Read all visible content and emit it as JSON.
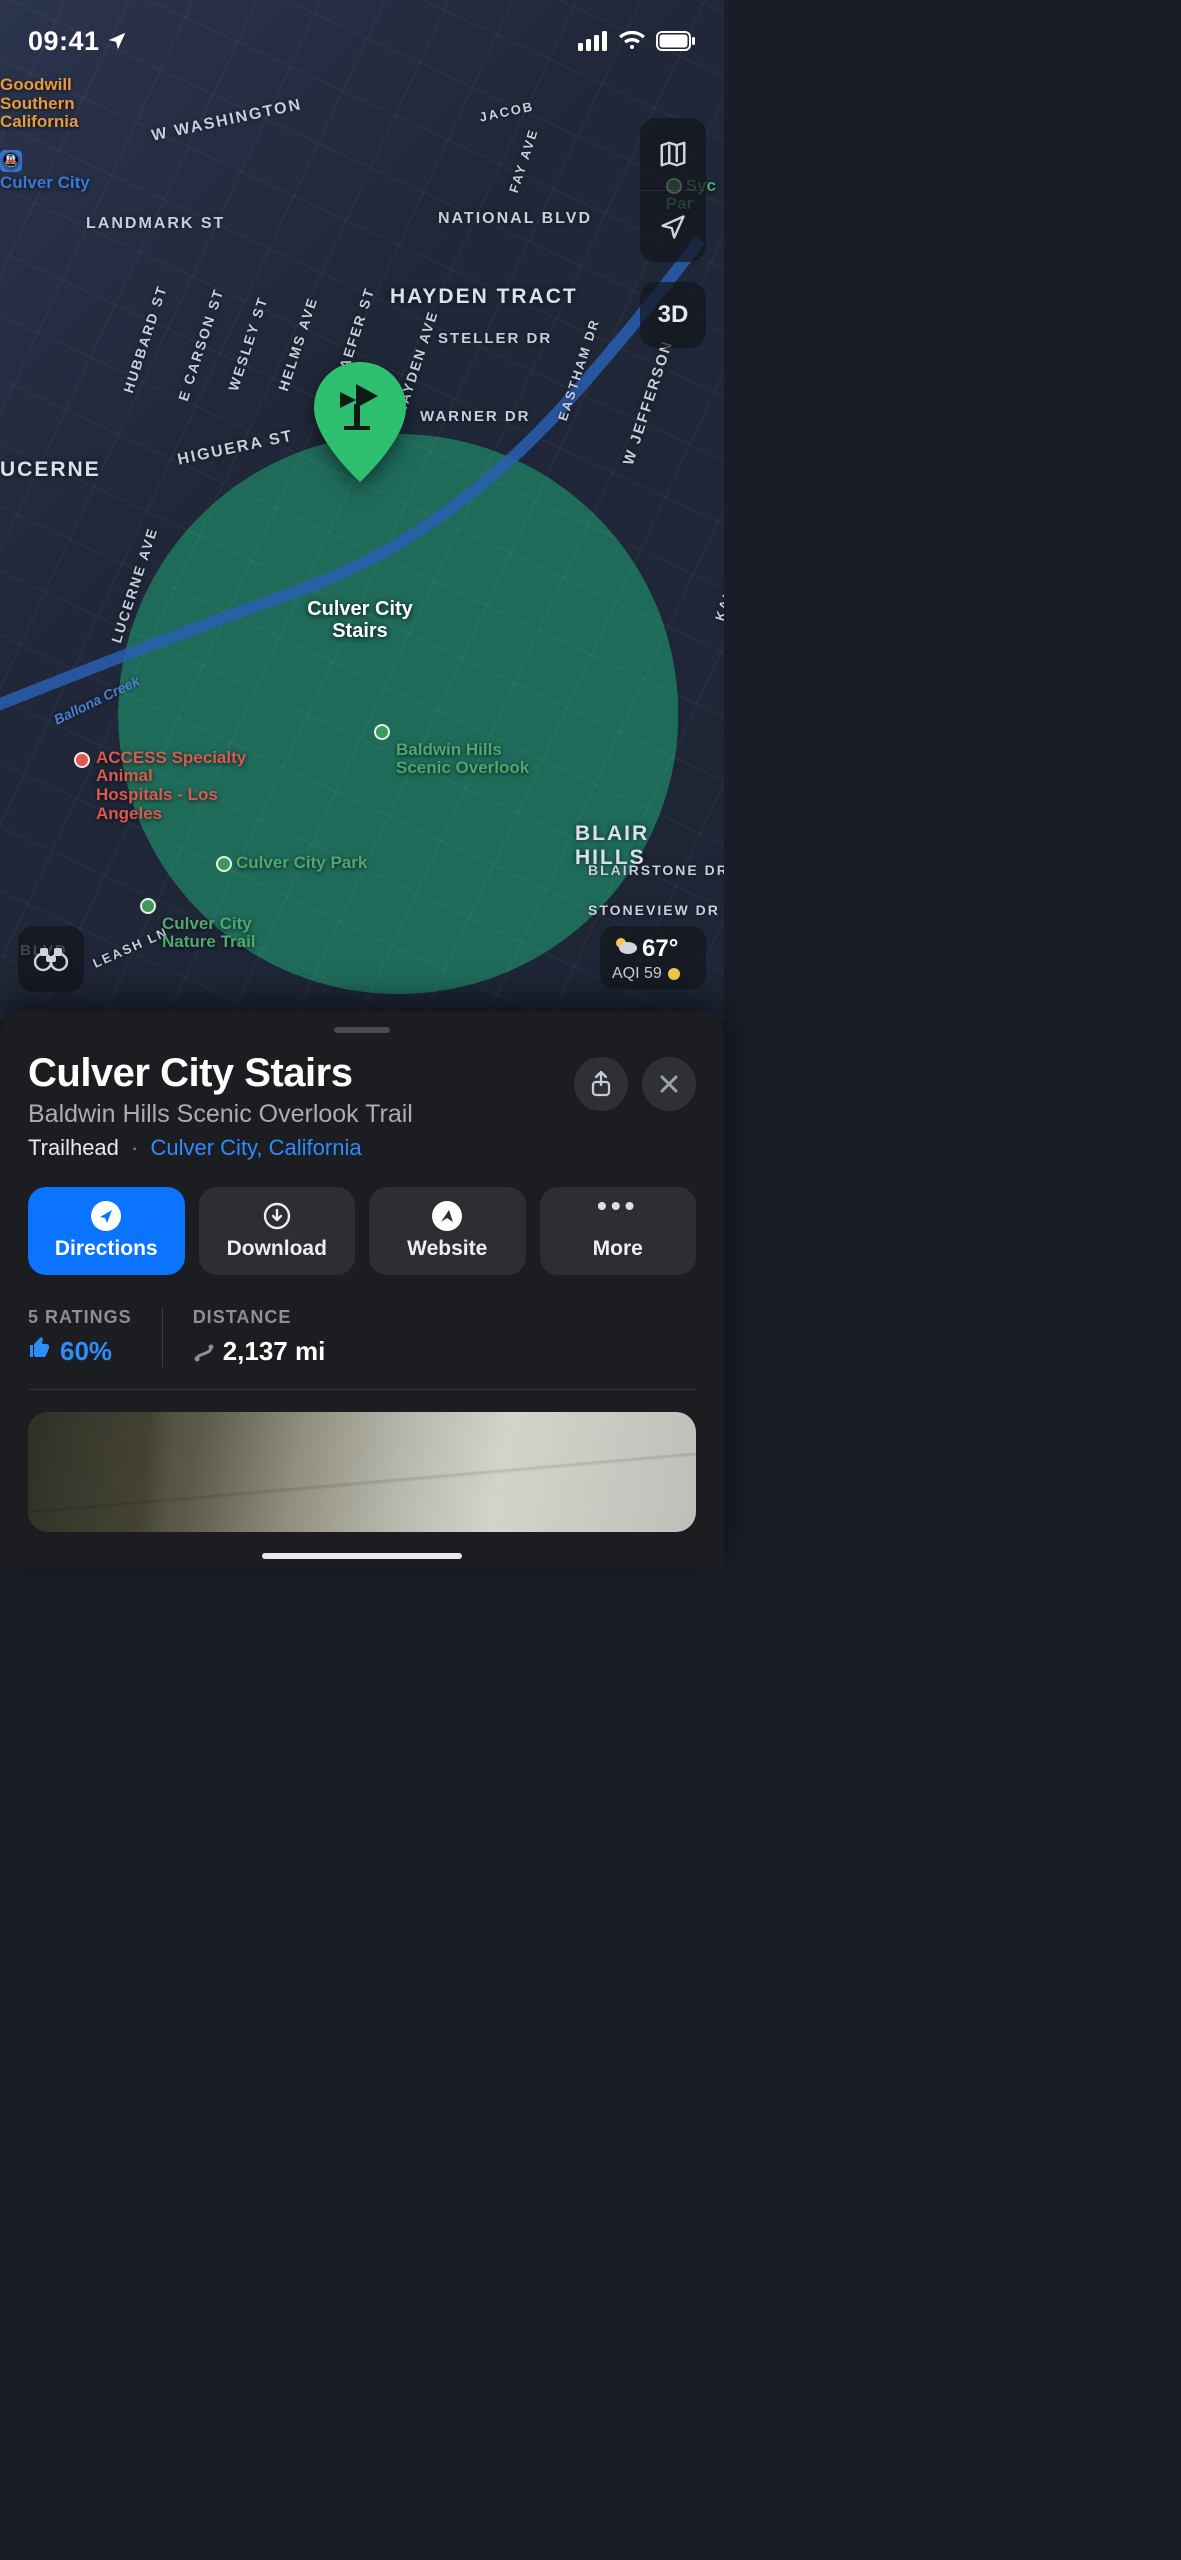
{
  "status": {
    "time": "09:41"
  },
  "map": {
    "pin_label": "Culver City\nStairs",
    "areas": {
      "hayden_tract": "HAYDEN TRACT",
      "blair_hills": "BLAIR HILLS",
      "lucerne": "UCERNE"
    },
    "roads": {
      "national": "NATIONAL BLVD",
      "w_washington": "W WASHINGTON",
      "landmark": "LANDMARK ST",
      "higuera": "HIGUERA ST",
      "steller": "STELLER DR",
      "warner": "WARNER DR",
      "hubbard": "HUBBARD ST",
      "e_carson": "E CARSON ST",
      "wesley": "WESLEY ST",
      "helms": "HELMS AVE",
      "schaefer": "SCHAEFER ST",
      "hayden_ave": "HAYDEN AVE",
      "eastham": "EASTHAM DR",
      "w_jefferson": "W JEFFERSON",
      "fay": "FAY AVE",
      "jacob": "JACOB",
      "lucerne_ave": "LUCERNE AVE",
      "leash_ln": "LEASH LN",
      "kalsman": "KALSMAN DR",
      "blairstone": "BLAIRSTONE DR",
      "stoneview": "STONEVIEW DR",
      "ballona": "Ballona Creek",
      "blvd": "BLVD"
    },
    "pois": {
      "goodwill": "Goodwill\nSouthern\nCalifornia",
      "culver_city_station": "Culver City",
      "sycamore_park": "Syc\nPar",
      "baldwin": "Baldwin Hills\nScenic Overlook",
      "access_vet": "ACCESS Specialty\nAnimal\nHospitals - Los\nAngeles",
      "cc_park": "Culver City Park",
      "cc_nature": "Culver City\nNature Trail"
    },
    "controls": {
      "three_d": "3D"
    },
    "weather": {
      "temp": "67°",
      "aqi_label": "AQI 59"
    }
  },
  "place": {
    "title": "Culver City Stairs",
    "subtitle": "Baldwin Hills Scenic Overlook Trail",
    "category": "Trailhead",
    "location": "Culver City, California",
    "actions": {
      "directions": "Directions",
      "download": "Download",
      "website": "Website",
      "more": "More"
    },
    "stats": {
      "ratings_label": "5 RATINGS",
      "ratings_value": "60%",
      "distance_label": "DISTANCE",
      "distance_value": "2,137 mi"
    }
  }
}
